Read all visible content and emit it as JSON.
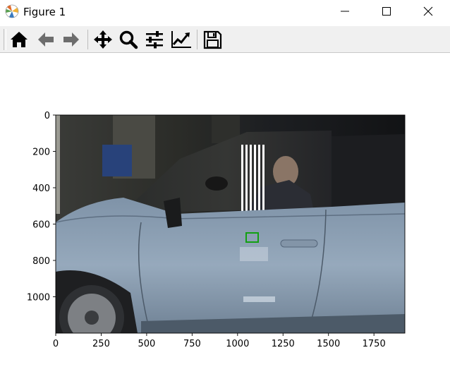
{
  "window": {
    "title": "Figure 1",
    "controls": [
      "minimize",
      "maximize",
      "close"
    ]
  },
  "toolbar": {
    "tools": [
      {
        "name": "home",
        "icon": "home-icon"
      },
      {
        "name": "back",
        "icon": "back-arrow-icon"
      },
      {
        "name": "forward",
        "icon": "forward-arrow-icon"
      },
      {
        "name": "pan",
        "icon": "move-icon"
      },
      {
        "name": "zoom",
        "icon": "zoom-icon"
      },
      {
        "name": "configure-subplots",
        "icon": "sliders-icon"
      },
      {
        "name": "edit-axis",
        "icon": "line-chart-icon"
      },
      {
        "name": "save",
        "icon": "save-icon"
      }
    ]
  },
  "plot": {
    "image": "photo of a light-blue car side with a driver, green rectangle marker on door",
    "x_ticks": [
      "0",
      "250",
      "500",
      "750",
      "1000",
      "1250",
      "1500",
      "1750"
    ],
    "y_ticks": [
      "0",
      "200",
      "400",
      "600",
      "800",
      "1000"
    ],
    "x_range": [
      0,
      1920
    ],
    "y_range": [
      0,
      1200
    ],
    "marker_color": "#12a012"
  }
}
